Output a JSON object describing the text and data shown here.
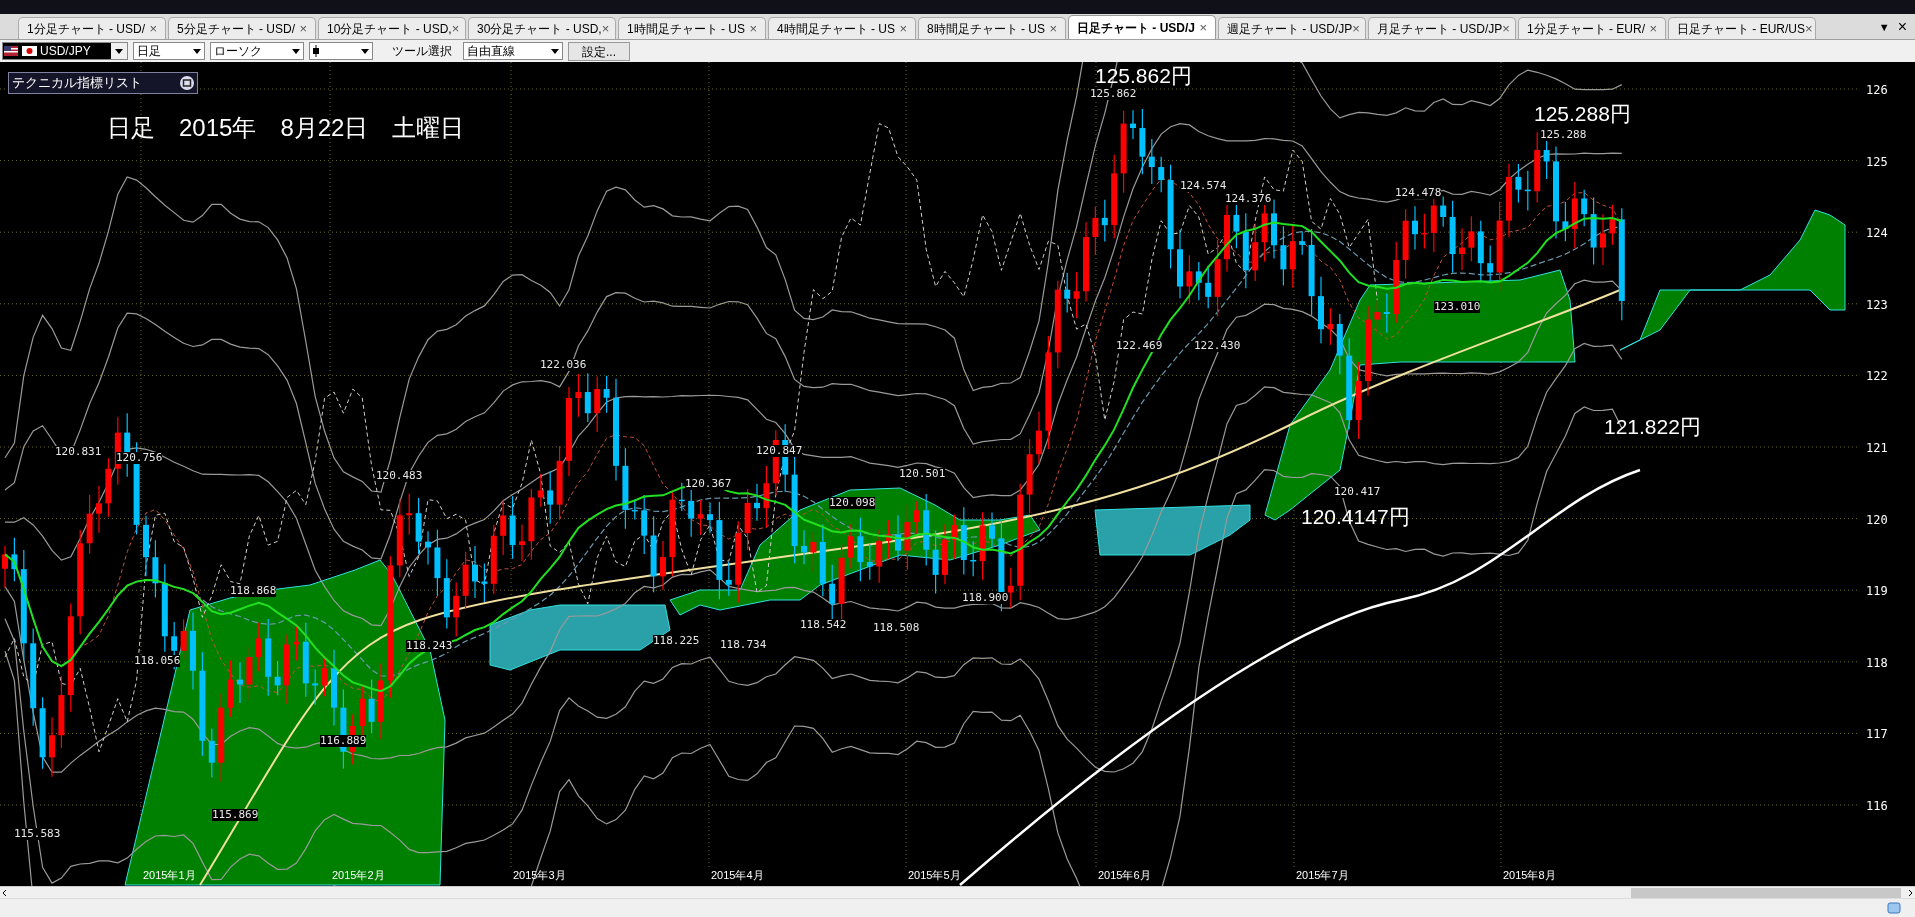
{
  "tabs": [
    {
      "label": "1分足チャート - USD/",
      "selected": false
    },
    {
      "label": "5分足チャート - USD/",
      "selected": false
    },
    {
      "label": "10分足チャート - USD,",
      "selected": false
    },
    {
      "label": "30分足チャート - USD,",
      "selected": false
    },
    {
      "label": "1時間足チャート - US",
      "selected": false
    },
    {
      "label": "4時間足チャート - US",
      "selected": false
    },
    {
      "label": "8時間足チャート - US",
      "selected": false
    },
    {
      "label": "日足チャート - USD/J",
      "selected": true
    },
    {
      "label": "週足チャート - USD/JP",
      "selected": false
    },
    {
      "label": "月足チャート - USD/JP",
      "selected": false
    },
    {
      "label": "1分足チャート - EUR/",
      "selected": false
    },
    {
      "label": "日足チャート - EUR/US",
      "selected": false
    }
  ],
  "tab_controls": {
    "menu": "▼",
    "close": "×"
  },
  "toolbar": {
    "symbol": "USD/JPY",
    "period": "日足",
    "chart_type": "ローソク",
    "tool_label": "ツール選択",
    "tool": "自由直線",
    "settings": "設定..."
  },
  "indicator_panel": {
    "title": "テクニカル指標リスト"
  },
  "chart": {
    "date_heading": "日足　2015年　8月22日　土曜日",
    "y_ticks": [
      "126",
      "125",
      "124",
      "123",
      "122",
      "121",
      "120",
      "119",
      "118",
      "117",
      "116"
    ],
    "x_labels": [
      "2015年1月",
      "2015年2月",
      "2015年3月",
      "2015年4月",
      "2015年5月",
      "2015年6月",
      "2015年7月",
      "2015年8月"
    ],
    "price_labels": [
      {
        "text": "125.862円",
        "kind": "big"
      },
      {
        "text": "125.862",
        "kind": "small"
      },
      {
        "text": "125.288円",
        "kind": "big"
      },
      {
        "text": "125.288",
        "kind": "small"
      },
      {
        "text": "121.822円",
        "kind": "big"
      },
      {
        "text": "120.4147円",
        "kind": "big"
      },
      {
        "text": "120.831",
        "kind": "small"
      },
      {
        "text": "120.756",
        "kind": "small"
      },
      {
        "text": "120.483",
        "kind": "small"
      },
      {
        "text": "122.036",
        "kind": "small"
      },
      {
        "text": "120.367",
        "kind": "small"
      },
      {
        "text": "120.847",
        "kind": "small"
      },
      {
        "text": "120.501",
        "kind": "small"
      },
      {
        "text": "120.098",
        "kind": "small"
      },
      {
        "text": "118.900",
        "kind": "small"
      },
      {
        "text": "124.574",
        "kind": "small"
      },
      {
        "text": "124.376",
        "kind": "small"
      },
      {
        "text": "124.478",
        "kind": "small"
      },
      {
        "text": "123.010",
        "kind": "small"
      },
      {
        "text": "122.469",
        "kind": "small"
      },
      {
        "text": "122.430",
        "kind": "small"
      },
      {
        "text": "120.417",
        "kind": "small"
      },
      {
        "text": "118.868",
        "kind": "small"
      },
      {
        "text": "118.056",
        "kind": "small"
      },
      {
        "text": "118.243",
        "kind": "small"
      },
      {
        "text": "118.225",
        "kind": "small"
      },
      {
        "text": "118.734",
        "kind": "small"
      },
      {
        "text": "118.542",
        "kind": "small"
      },
      {
        "text": "118.508",
        "kind": "small"
      },
      {
        "text": "116.889",
        "kind": "small"
      },
      {
        "text": "115.869",
        "kind": "small"
      },
      {
        "text": "115.583",
        "kind": "small"
      }
    ]
  }
}
